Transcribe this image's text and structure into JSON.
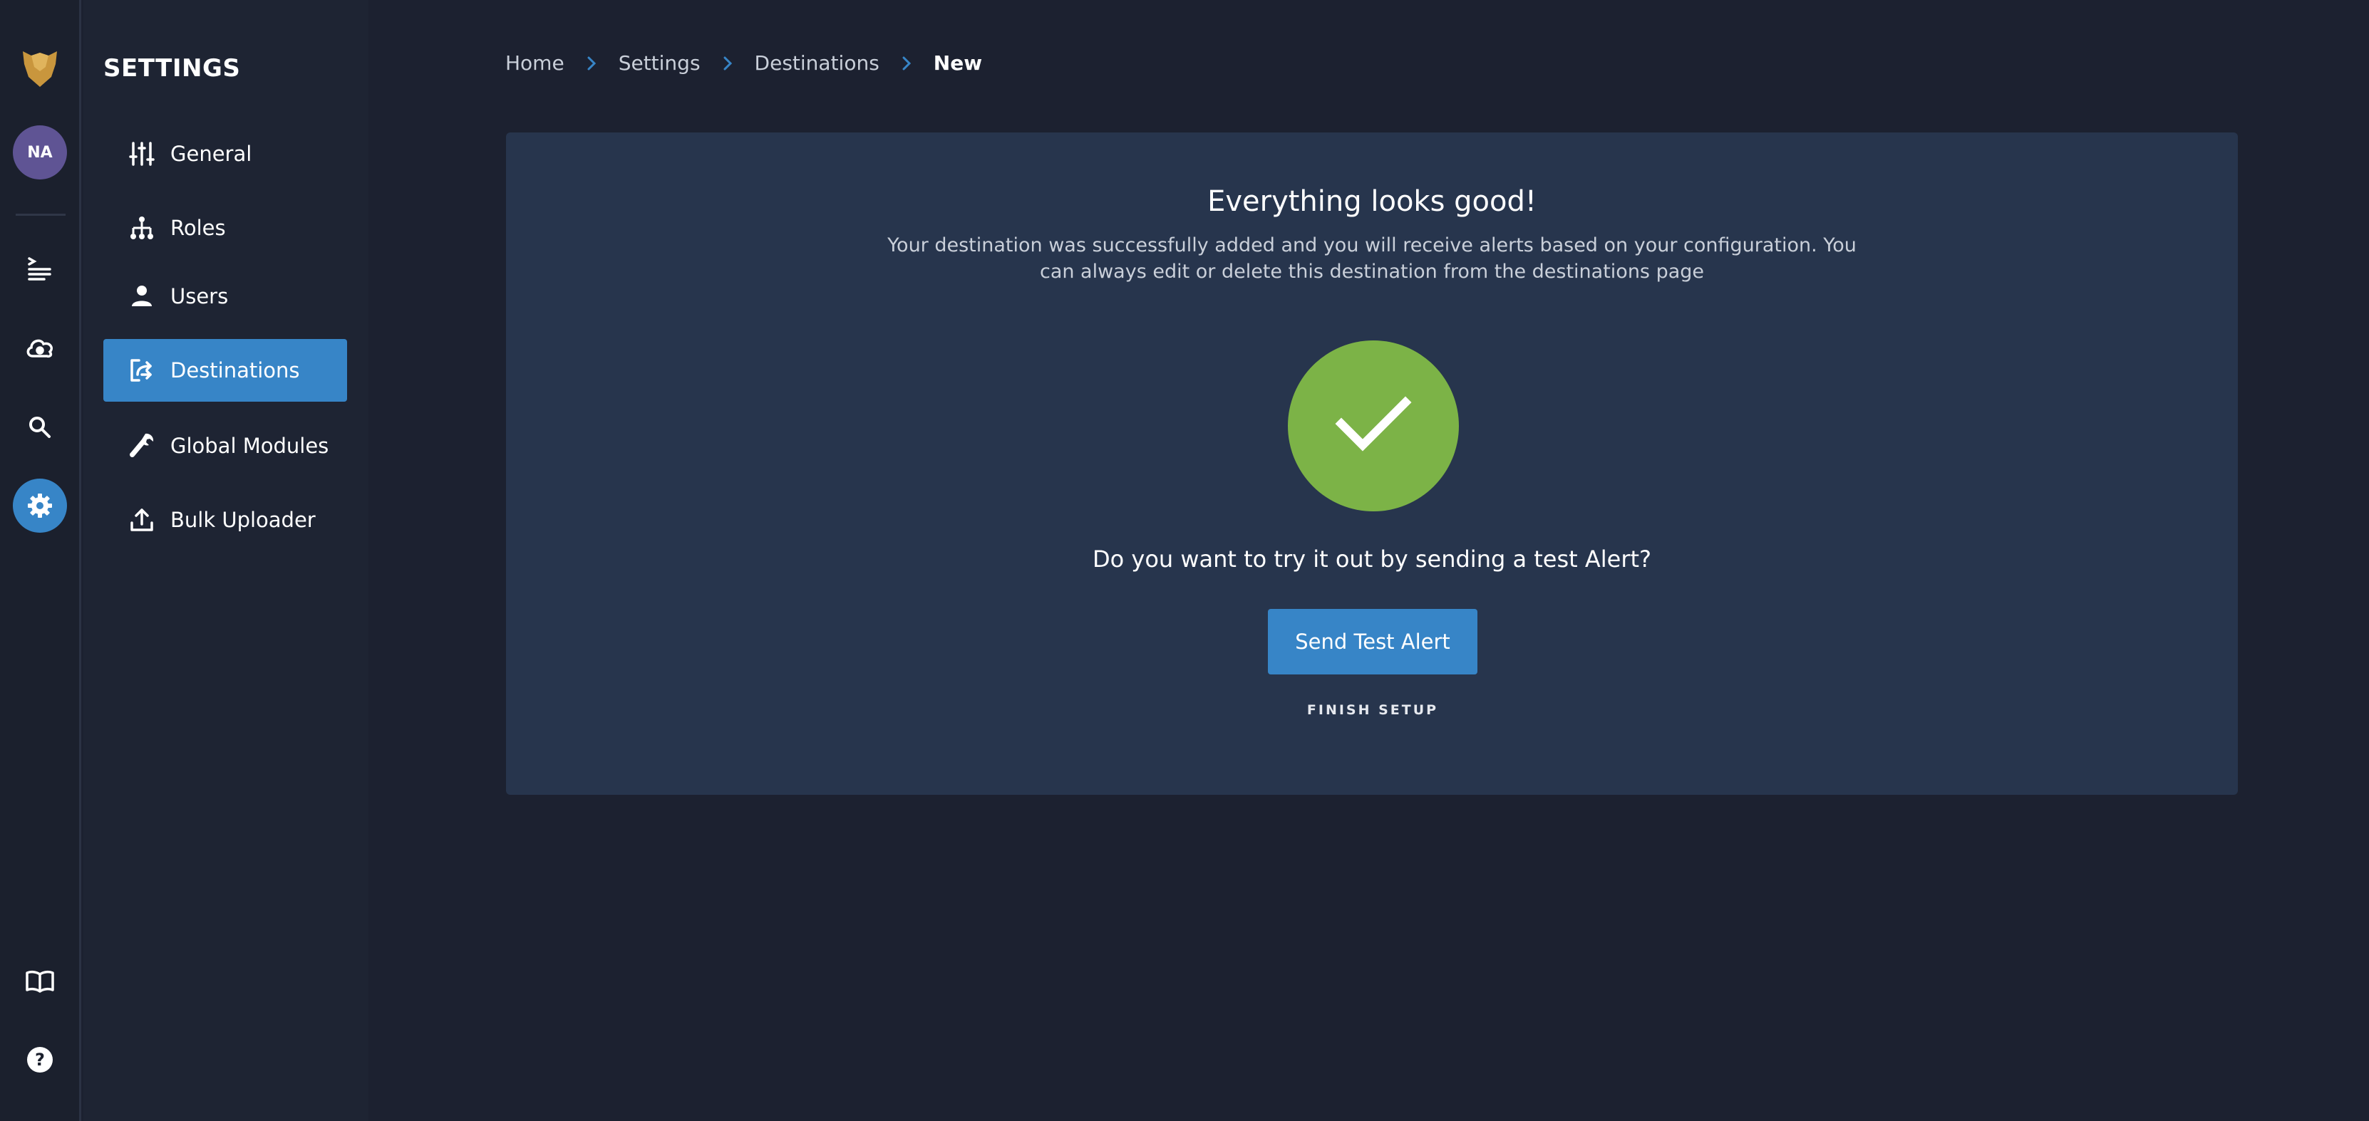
{
  "rail": {
    "avatar_initials": "NA",
    "icons": [
      "panther-logo-icon",
      "alerts-icon",
      "cloud-icon",
      "search-icon",
      "gear-icon",
      "book-icon",
      "help-icon"
    ]
  },
  "settings_nav": {
    "title": "SETTINGS",
    "items": [
      {
        "label": "General",
        "icon": "sliders-icon"
      },
      {
        "label": "Roles",
        "icon": "hierarchy-icon"
      },
      {
        "label": "Users",
        "icon": "user-icon"
      },
      {
        "label": "Destinations",
        "icon": "destinations-icon",
        "active": true
      },
      {
        "label": "Global Modules",
        "icon": "wrench-icon"
      },
      {
        "label": "Bulk Uploader",
        "icon": "upload-icon"
      }
    ]
  },
  "breadcrumb": {
    "items": [
      "Home",
      "Settings",
      "Destinations"
    ],
    "current": "New"
  },
  "card": {
    "title": "Everything looks good!",
    "description": "Your destination was successfully added and you will receive alerts based on your configuration. You can always edit or delete this destination from the destinations page",
    "prompt": "Do you want to try it out by sending a test Alert?",
    "send_button": "Send Test Alert",
    "finish_button": "FINISH SETUP"
  },
  "colors": {
    "accent": "#3785c7",
    "success": "#7cb347",
    "avatar": "#5f5494",
    "card": "#27354d",
    "background": "#1c2130"
  }
}
